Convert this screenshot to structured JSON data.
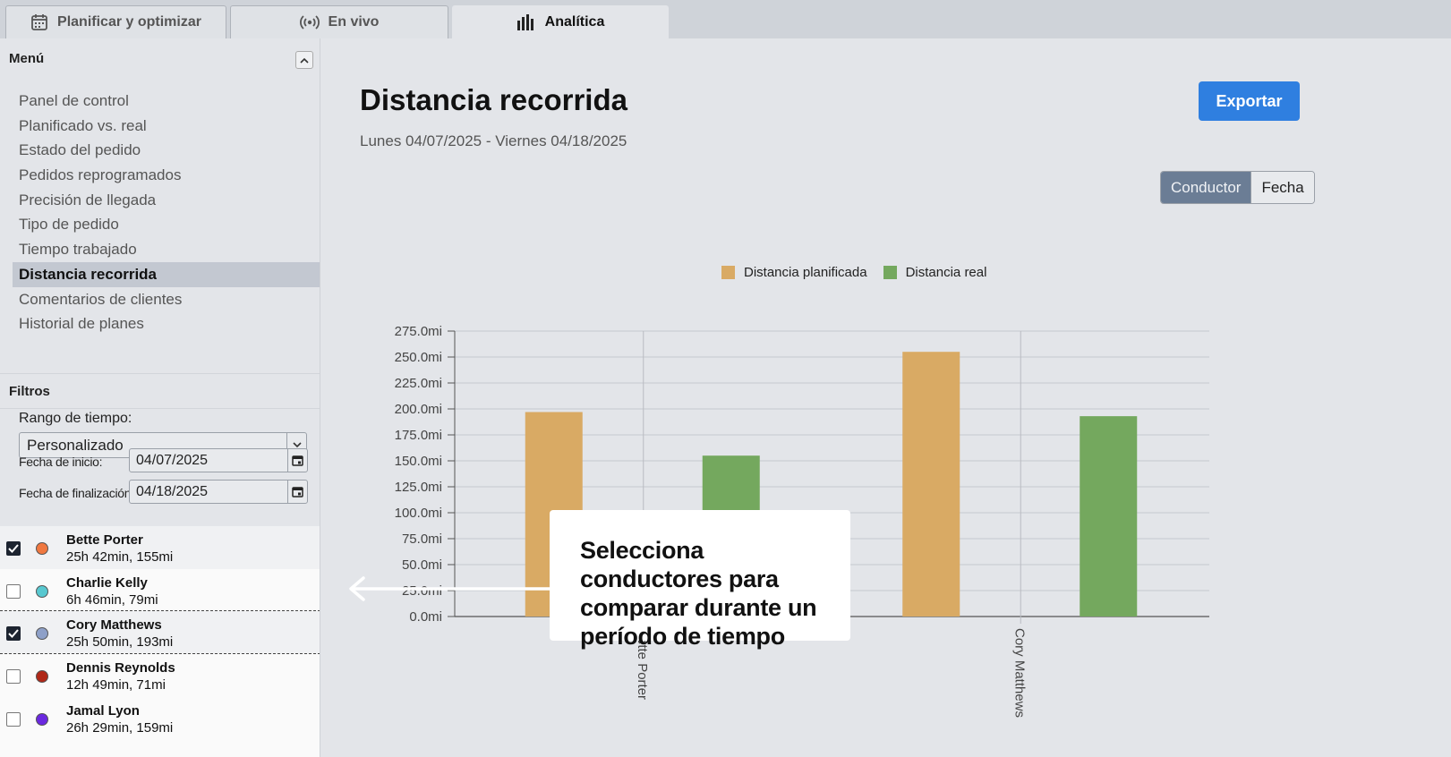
{
  "tabs": [
    {
      "label": "Planificar y optimizar",
      "icon": "calendar-icon"
    },
    {
      "label": "En vivo",
      "icon": "broadcast-icon"
    },
    {
      "label": "Analítica",
      "icon": "bar-chart-icon"
    }
  ],
  "sidebar": {
    "menu_title": "Menú",
    "menu_items": [
      "Panel de control",
      "Planificado vs. real",
      "Estado del pedido",
      "Pedidos reprogramados",
      "Precisión de llegada",
      "Tipo de pedido",
      "Tiempo trabajado",
      "Distancia recorrida",
      "Comentarios de clientes",
      "Historial de planes"
    ],
    "active_item": "Distancia recorrida",
    "filters_title": "Filtros",
    "range_label": "Rango de tiempo:",
    "range_value": "Personalizado",
    "start_label": "Fecha de inicio:",
    "start_value": "04/07/2025",
    "end_label": "Fecha de finalización:",
    "end_value": "04/18/2025",
    "drivers": [
      {
        "name": "Bette Porter",
        "stats": "25h 42min, 155mi",
        "checked": true,
        "color": "#f07840"
      },
      {
        "name": "Charlie Kelly",
        "stats": "6h 46min, 79mi",
        "checked": false,
        "color": "#58c8d0"
      },
      {
        "name": "Cory Matthews",
        "stats": "25h 50min, 193mi",
        "checked": true,
        "color": "#8ea0c8"
      },
      {
        "name": "Dennis Reynolds",
        "stats": "12h 49min, 71mi",
        "checked": false,
        "color": "#b02818"
      },
      {
        "name": "Jamal Lyon",
        "stats": "26h 29min, 159mi",
        "checked": false,
        "color": "#6a28e0"
      }
    ]
  },
  "main": {
    "title": "Distancia recorrida",
    "date_range": "Lunes 04/07/2025 - Viernes 04/18/2025",
    "export_label": "Exportar",
    "toggle": {
      "option1": "Conductor",
      "option2": "Fecha",
      "selected": "Conductor"
    },
    "callout_text": "Selecciona conductores para comparar durante un período de tiempo"
  },
  "chart_data": {
    "type": "bar",
    "categories": [
      "Bette Porter",
      "Cory Matthews"
    ],
    "series": [
      {
        "name": "Distancia planificada",
        "values": [
          197,
          255
        ],
        "color": "#d9aa64"
      },
      {
        "name": "Distancia real",
        "values": [
          155,
          193
        ],
        "color": "#74a85e"
      }
    ],
    "ylim": [
      0,
      275
    ],
    "yticks": [
      "0.0mi",
      "25.0mi",
      "50.0mi",
      "75.0mi",
      "100.0mi",
      "125.0mi",
      "150.0mi",
      "175.0mi",
      "200.0mi",
      "225.0mi",
      "250.0mi",
      "275.0mi"
    ],
    "legend_position": "top-center",
    "grid": true
  }
}
